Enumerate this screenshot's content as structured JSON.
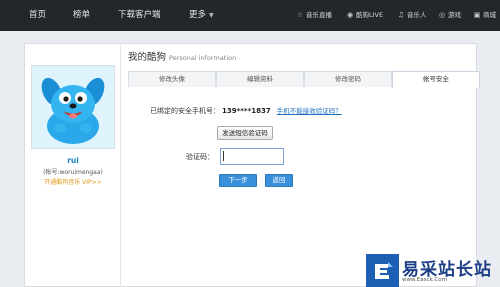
{
  "topnav": {
    "items": [
      "首页",
      "榜单",
      "下载客户端",
      "更多"
    ],
    "right": [
      {
        "icon": "star-icon",
        "label": "音乐直播"
      },
      {
        "icon": "live-icon",
        "label": "酷狗LIVE"
      },
      {
        "icon": "headphones-icon",
        "label": "音乐人"
      },
      {
        "icon": "gamepad-icon",
        "label": "游戏"
      },
      {
        "icon": "shop-icon",
        "label": "商城"
      }
    ]
  },
  "page": {
    "title": "我的酷狗",
    "subtitle": "Personal information"
  },
  "user": {
    "name": "rui",
    "account": "(帐号:woruimengaa)",
    "vip": "开通酷狗音乐 VIP>>"
  },
  "tabs": [
    "修改头像",
    "编辑资料",
    "修改密码",
    "帐号安全"
  ],
  "active_tab": "帐号安全",
  "security": {
    "phone_label": "已绑定的安全手机号：",
    "phone_number": "139****1837",
    "cannot_receive_link": "手机不能接收验证码？",
    "send_sms_button": "发送短信验证码",
    "code_label": "验证码：",
    "code_value": "",
    "next_button": "下一步",
    "back_button": "返回"
  },
  "watermark": {
    "text": "易采站长站",
    "url": "www.Easck.Com"
  }
}
